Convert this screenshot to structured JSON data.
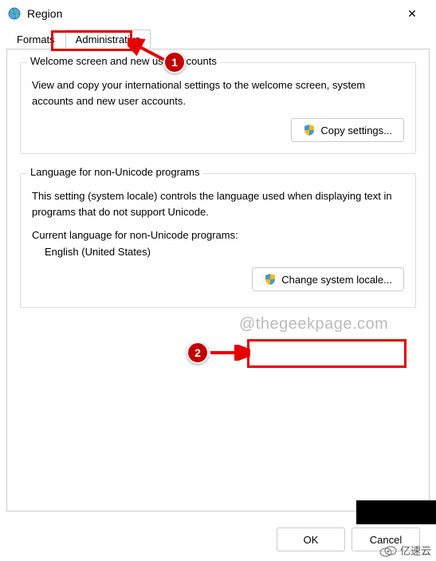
{
  "window": {
    "title": "Region",
    "close_label": "✕"
  },
  "tabs": {
    "formats": "Formats",
    "administrative": "Administrative"
  },
  "group1": {
    "title": "Welcome screen and new user accounts",
    "desc": "View and copy your international settings to the welcome screen, system accounts and new user accounts.",
    "button": "Copy settings..."
  },
  "group2": {
    "title": "Language for non-Unicode programs",
    "desc": "This setting (system locale) controls the language used when displaying text in programs that do not support Unicode.",
    "label": "Current language for non-Unicode programs:",
    "value": "English (United States)",
    "button": "Change system locale..."
  },
  "footer": {
    "ok": "OK",
    "cancel": "Cancel"
  },
  "annotations": {
    "badge1": "1",
    "badge2": "2"
  },
  "watermark": "@thegeekpage.com",
  "partner": "亿速云"
}
